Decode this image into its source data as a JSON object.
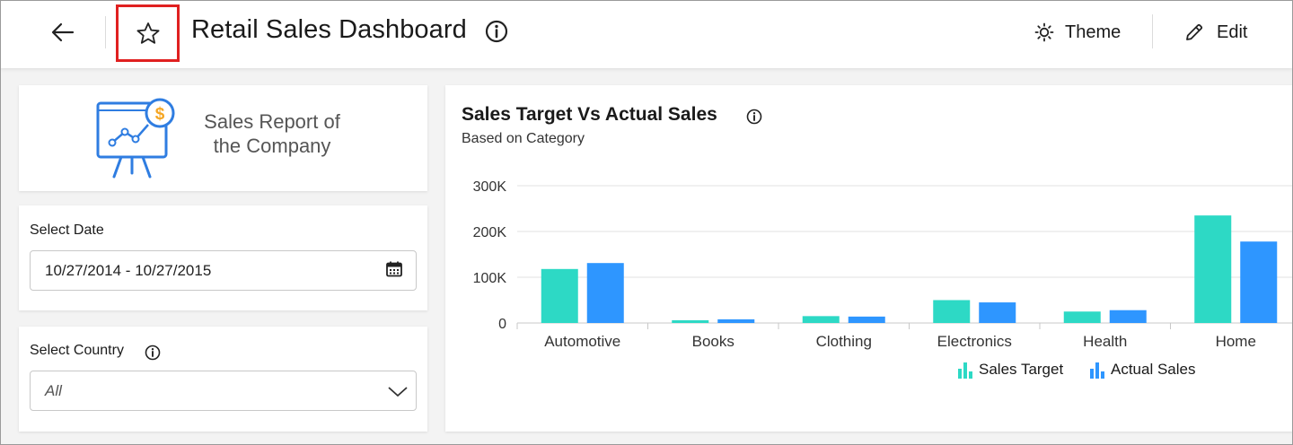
{
  "header": {
    "title": "Retail Sales Dashboard",
    "theme_label": "Theme",
    "edit_label": "Edit"
  },
  "logo": {
    "line1": "Sales Report of",
    "line2": "the Company"
  },
  "date_filter": {
    "label": "Select Date",
    "value": "10/27/2014 - 10/27/2015"
  },
  "country_filter": {
    "label": "Select Country",
    "value": "All"
  },
  "chart": {
    "title": "Sales Target Vs Actual Sales",
    "subtitle": "Based on Category",
    "legend": [
      "Sales Target",
      "Actual Sales"
    ]
  },
  "colors": {
    "sales_target": "#2dd9c5",
    "actual_sales": "#2e96ff",
    "highlight": "#e02020",
    "logo_blue": "#2f7de1",
    "logo_gold": "#f5a623"
  },
  "icons": [
    "arrow-left-icon",
    "star-icon",
    "info-icon",
    "sun-icon",
    "pencil-icon",
    "calendar-icon",
    "chevron-down-icon",
    "bar-chart-icon"
  ],
  "chart_data": {
    "type": "bar",
    "categories": [
      "Automotive",
      "Books",
      "Clothing",
      "Electronics",
      "Health",
      "Home"
    ],
    "series": [
      {
        "name": "Sales Target",
        "values": [
          118000,
          6000,
          15000,
          50000,
          25000,
          235000
        ]
      },
      {
        "name": "Actual Sales",
        "values": [
          131000,
          8000,
          14000,
          45000,
          28000,
          178000
        ]
      }
    ],
    "ylim": [
      0,
      300000
    ],
    "yticks": [
      0,
      100000,
      200000,
      300000
    ],
    "ytick_labels": [
      "0",
      "100K",
      "200K",
      "300K"
    ],
    "grid": true,
    "legend_position": "bottom"
  }
}
